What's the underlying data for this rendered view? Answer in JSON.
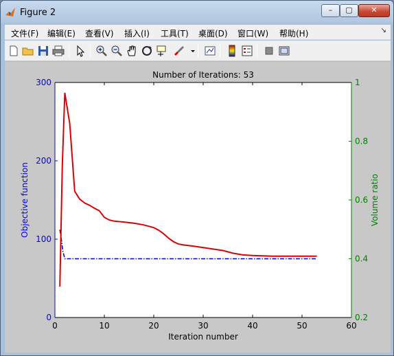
{
  "window": {
    "title": "Figure 2"
  },
  "menu": [
    "文件(F)",
    "编辑(E)",
    "查看(V)",
    "插入(I)",
    "工具(T)",
    "桌面(D)",
    "窗口(W)",
    "帮助(H)"
  ],
  "toolbar": {
    "icons": [
      "new-file-icon",
      "open-folder-icon",
      "save-icon",
      "print-icon",
      "pointer-icon",
      "zoom-in-icon",
      "zoom-out-icon",
      "pan-hand-icon",
      "rotate-3d-icon",
      "data-cursor-icon",
      "brush-icon",
      "link-plot-icon",
      "colorbar-icon",
      "legend-icon",
      "hide-plot-tools-icon",
      "show-plot-tools-icon"
    ]
  },
  "colors": {
    "left_axis": "#0000ff",
    "right_axis": "#008000",
    "objective": "#0000cc",
    "volume": "#dd0000"
  },
  "chart_data": {
    "type": "line",
    "title": "Number of Iterations: 53",
    "xlabel": "Iteration number",
    "ylabel_left": "Objective function",
    "ylabel_right": "Volume ratio",
    "xlim": [
      0,
      60
    ],
    "ylim_left": [
      0,
      300
    ],
    "ylim_right": [
      0.2,
      1
    ],
    "xticks": [
      "0",
      "10",
      "20",
      "30",
      "40",
      "50",
      "60"
    ],
    "yticks_left": [
      "0",
      "100",
      "200",
      "300"
    ],
    "yticks_right": [
      "0.2",
      "0.4",
      "0.6",
      "0.8",
      "1"
    ],
    "grid": false,
    "series": [
      {
        "axis": "left",
        "style": "dash-dot",
        "x": [
          1,
          1.3,
          1.6,
          2,
          3,
          5,
          10,
          20,
          30,
          40,
          53
        ],
        "y": [
          112,
          100,
          85,
          75,
          75,
          75,
          75,
          75,
          75,
          75,
          75
        ]
      },
      {
        "axis": "right",
        "style": "solid",
        "x": [
          1,
          1.5,
          2,
          3,
          4,
          5,
          6,
          7,
          8,
          9,
          10,
          11,
          12,
          14,
          16,
          18,
          20,
          21,
          22,
          23,
          24,
          25,
          26,
          28,
          30,
          32,
          34,
          36,
          38,
          40,
          42,
          44,
          46,
          48,
          50,
          53
        ],
        "y": [
          0.305,
          0.72,
          0.965,
          0.86,
          0.63,
          0.603,
          0.59,
          0.582,
          0.572,
          0.563,
          0.541,
          0.532,
          0.528,
          0.525,
          0.521,
          0.515,
          0.506,
          0.497,
          0.485,
          0.47,
          0.458,
          0.45,
          0.447,
          0.443,
          0.438,
          0.433,
          0.428,
          0.419,
          0.413,
          0.411,
          0.41,
          0.409,
          0.409,
          0.409,
          0.409,
          0.409
        ]
      }
    ]
  }
}
